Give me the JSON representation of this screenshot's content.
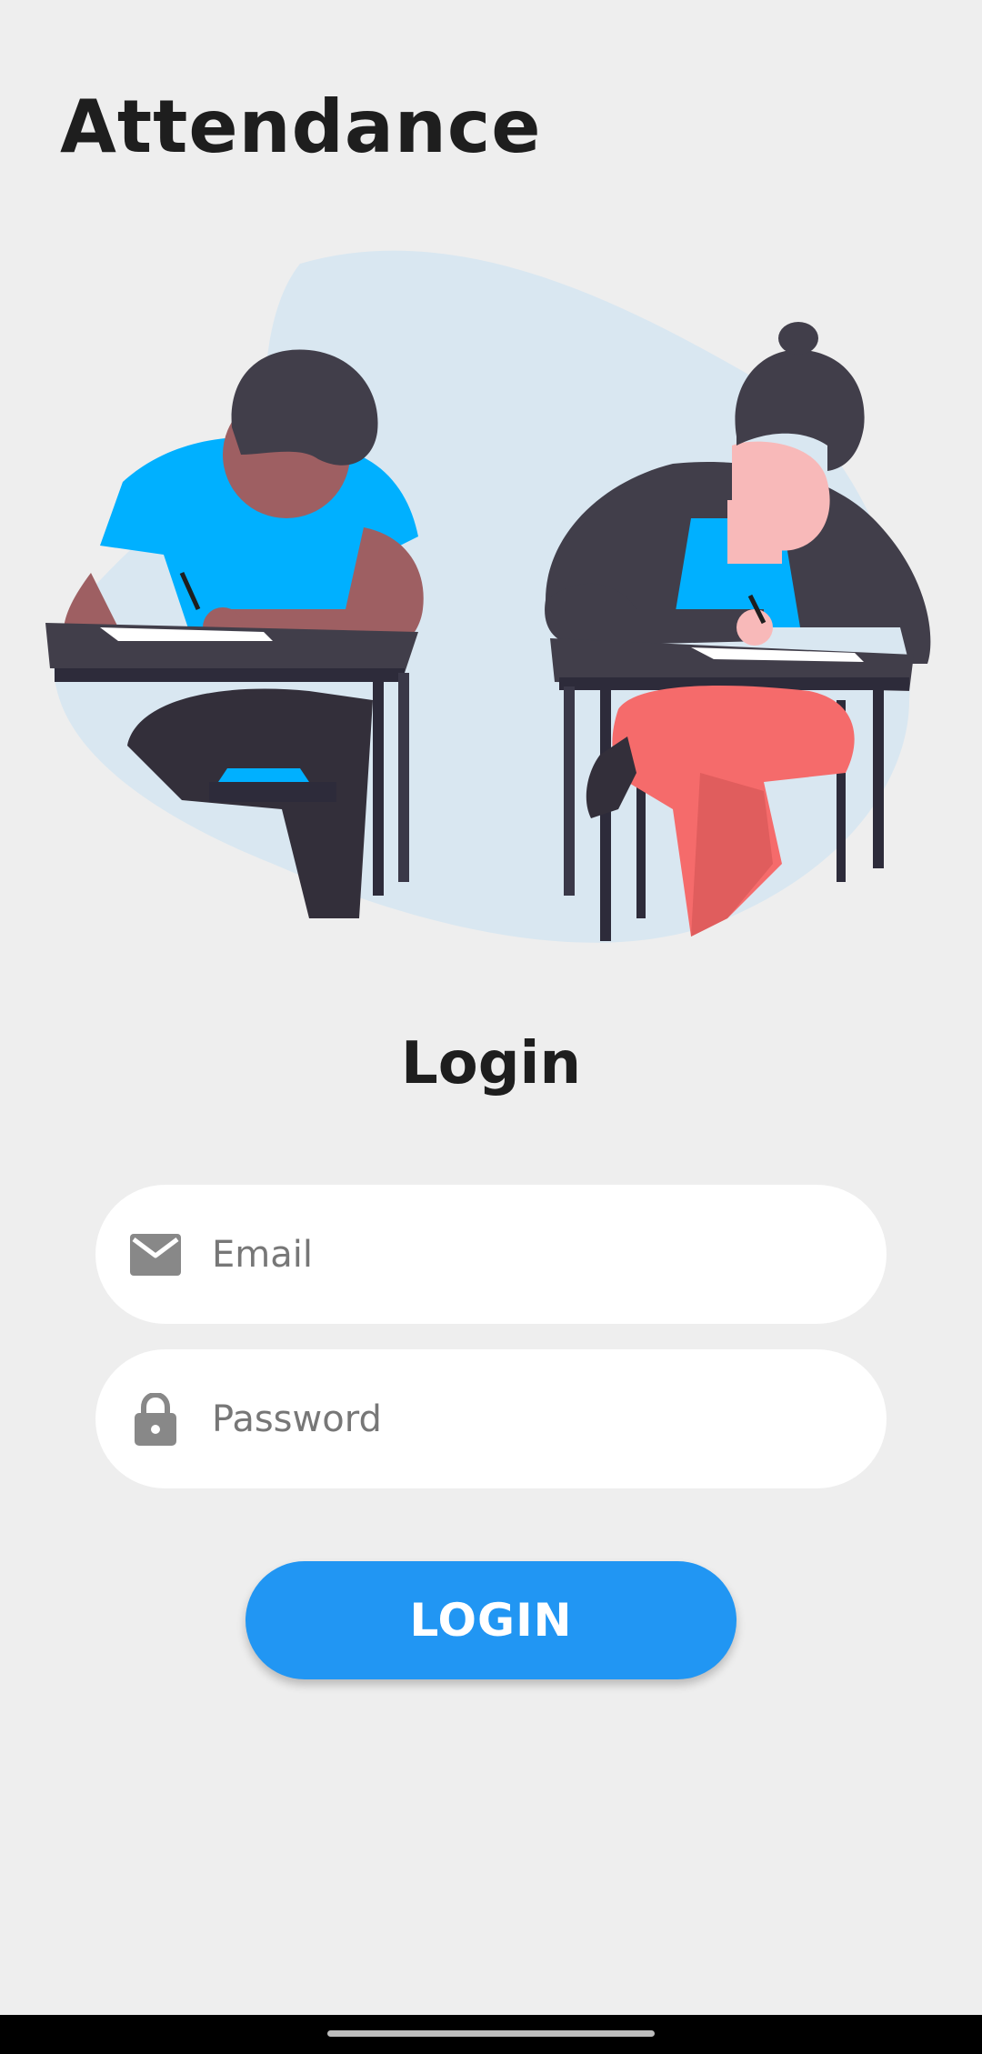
{
  "header": {
    "title": "Attendance"
  },
  "illustration": {
    "description_icon": "students-writing-illustration",
    "blob_color": "#d9e7f1"
  },
  "login": {
    "heading": "Login",
    "email": {
      "placeholder": "Email",
      "value": "",
      "icon": "mail-icon"
    },
    "password": {
      "placeholder": "Password",
      "value": "",
      "icon": "lock-icon"
    },
    "button_label": "LOGIN"
  },
  "colors": {
    "accent": "#2196f3",
    "background": "#eeeeee",
    "icon_gray": "#888888"
  }
}
